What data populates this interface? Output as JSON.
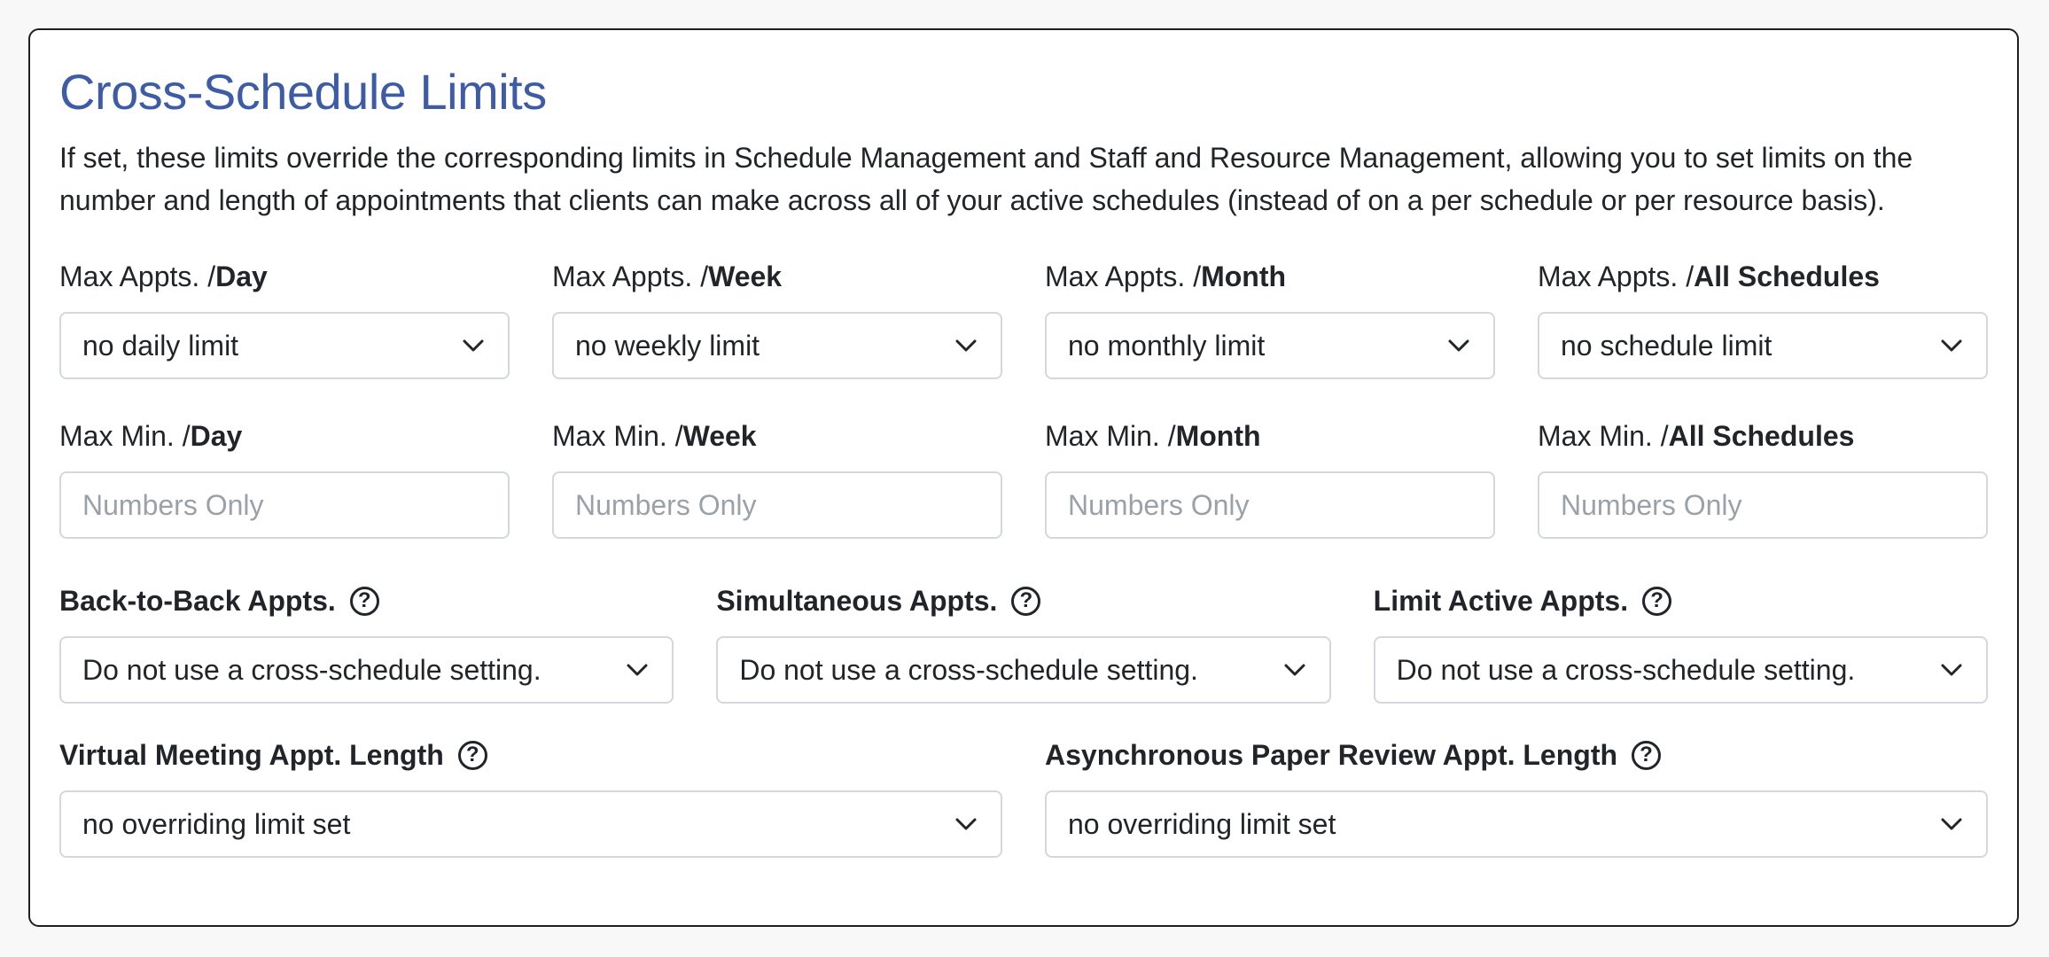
{
  "card": {
    "title": "Cross-Schedule Limits",
    "description": "If set, these limits override the corresponding limits in Schedule Management and Staff and Resource Management, allowing you to set limits on the number and length of appointments that clients can make across all of your active schedules (instead of on a per schedule or per resource basis)."
  },
  "max_appts": [
    {
      "prefix": "Max Appts. / ",
      "period": "Day",
      "value": "no daily limit"
    },
    {
      "prefix": "Max Appts. / ",
      "period": "Week",
      "value": "no weekly limit"
    },
    {
      "prefix": "Max Appts. / ",
      "period": "Month",
      "value": "no monthly limit"
    },
    {
      "prefix": "Max Appts. / ",
      "period": "All Schedules",
      "value": "no schedule limit"
    }
  ],
  "max_minutes": [
    {
      "prefix": "Max Min. / ",
      "period": "Day",
      "placeholder": "Numbers Only"
    },
    {
      "prefix": "Max Min. / ",
      "period": "Week",
      "placeholder": "Numbers Only"
    },
    {
      "prefix": "Max Min. / ",
      "period": "Month",
      "placeholder": "Numbers Only"
    },
    {
      "prefix": "Max Min. / ",
      "period": "All Schedules",
      "placeholder": "Numbers Only"
    }
  ],
  "settings": [
    {
      "label": "Back-to-Back Appts.",
      "value": "Do not use a cross-schedule setting."
    },
    {
      "label": "Simultaneous Appts.",
      "value": "Do not use a cross-schedule setting."
    },
    {
      "label": "Limit Active Appts.",
      "value": "Do not use a cross-schedule setting."
    }
  ],
  "lengths": [
    {
      "label": "Virtual Meeting Appt. Length",
      "value": "no overriding limit set"
    },
    {
      "label": "Asynchronous Paper Review Appt. Length",
      "value": "no overriding limit set"
    }
  ],
  "help_glyph": "?",
  "icons": {
    "help": "question-circle-icon",
    "dropdown": "chevron-down-icon"
  },
  "colors": {
    "title": "#3e5ba6",
    "border": "#d4d7db",
    "placeholder": "#9aa1a9"
  }
}
